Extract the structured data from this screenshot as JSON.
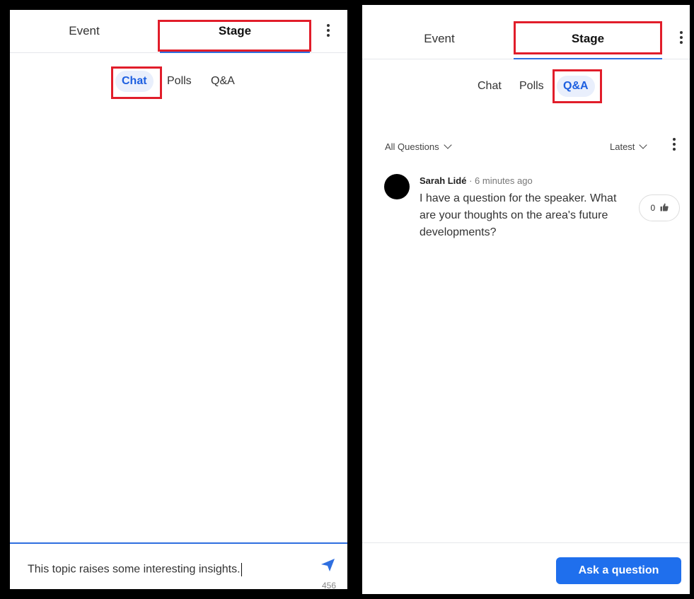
{
  "left_panel": {
    "tabs": {
      "event": "Event",
      "stage": "Stage"
    },
    "sub_tabs": {
      "chat": "Chat",
      "polls": "Polls",
      "qa": "Q&A"
    },
    "composer": {
      "value": "This topic raises some interesting insights.",
      "char_count": "456"
    }
  },
  "right_panel": {
    "tabs": {
      "event": "Event",
      "stage": "Stage"
    },
    "sub_tabs": {
      "chat": "Chat",
      "polls": "Polls",
      "qa": "Q&A"
    },
    "filter": "All Questions",
    "sort": "Latest",
    "question": {
      "author": "Sarah Lidé",
      "time": "· 6 minutes ago",
      "text": "I have a question for the speaker. What are your thoughts on the area's future developments?",
      "likes": "0"
    },
    "ask_button": "Ask a question"
  },
  "colors": {
    "accent": "#1f6fed",
    "highlight": "#e11d2a"
  },
  "icons": [
    "kebab-menu-icon",
    "send-icon",
    "chevron-down-icon",
    "thumbs-up-icon"
  ]
}
